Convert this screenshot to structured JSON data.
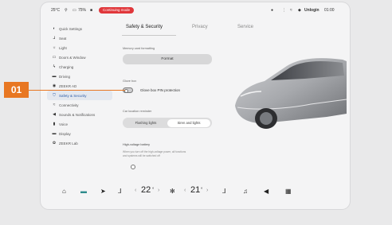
{
  "status_bar": {
    "temperature": "25°C",
    "battery_pct": "75%",
    "recording_label": "Continuing mode",
    "user": "Unlogin",
    "time": "01:00"
  },
  "sidebar": {
    "items": [
      {
        "label": "Quick Settings",
        "icon": "toggle-icon"
      },
      {
        "label": "Seat",
        "icon": "seat-icon"
      },
      {
        "label": "Light",
        "icon": "light-icon"
      },
      {
        "label": "Doors & Window",
        "icon": "door-icon"
      },
      {
        "label": "Charging",
        "icon": "charging-icon"
      },
      {
        "label": "Driving",
        "icon": "car-icon"
      },
      {
        "label": "ZEEKR AD",
        "icon": "ad-icon"
      },
      {
        "label": "Safety & Security",
        "icon": "shield-icon",
        "active": true
      },
      {
        "label": "Connectivity",
        "icon": "wifi-icon"
      },
      {
        "label": "Sounds & Notifications",
        "icon": "speaker-icon"
      },
      {
        "label": "Voice",
        "icon": "mic-icon"
      },
      {
        "label": "Display",
        "icon": "display-icon"
      },
      {
        "label": "ZEEKR Lab",
        "icon": "lab-icon"
      }
    ]
  },
  "tabs": [
    {
      "label": "Safety & Security",
      "active": true
    },
    {
      "label": "Privacy",
      "active": false
    },
    {
      "label": "Service",
      "active": false
    }
  ],
  "settings": {
    "memory_label": "Memory card formatting",
    "format_button": "Format",
    "glovebox_label": "Glove box",
    "glovebox_toggle_label": "Glove box PIN protection",
    "glovebox_toggle_on": false,
    "car_location_label": "Car location reminder",
    "car_location_options": [
      "Flashing lights",
      "Siren and lights"
    ],
    "car_location_selected": 1,
    "hv_battery_label": "High-voltage battery",
    "hv_battery_desc_1": "When you turn off the high-voltage power, all functions",
    "hv_battery_desc_2": "and systems will be switched off"
  },
  "dock": {
    "left_temp": "22",
    "right_temp": "21"
  },
  "callout": {
    "label": "01"
  },
  "colors": {
    "accent": "#2f5ea8",
    "callout": "#e87722",
    "recording": "#e0373b"
  }
}
